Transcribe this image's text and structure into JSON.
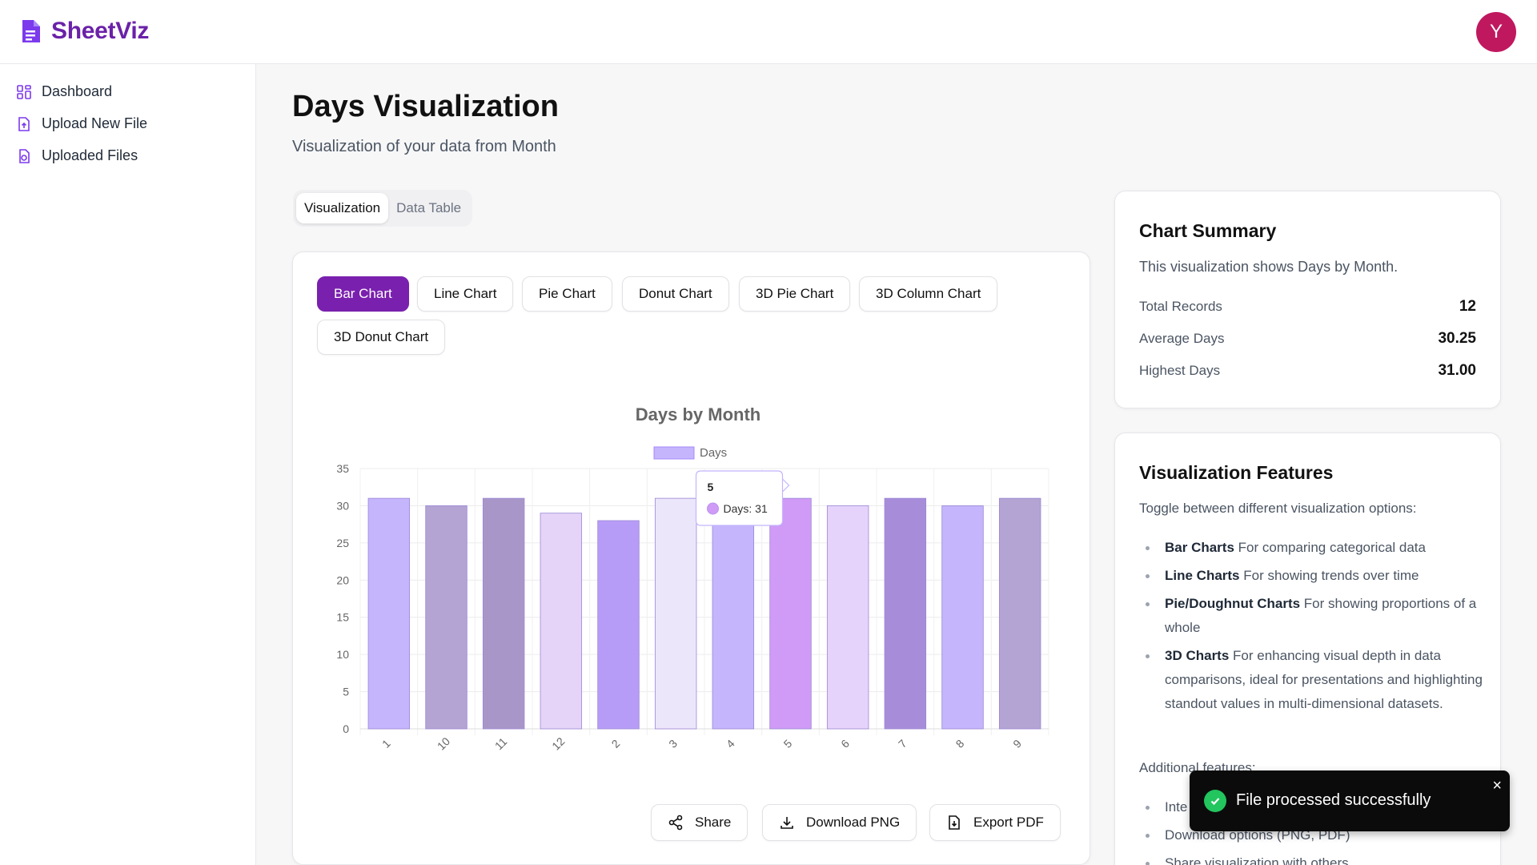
{
  "brand": {
    "name": "SheetViz"
  },
  "user": {
    "avatar_letter": "Y",
    "avatar_color": "#c0185f"
  },
  "sidebar": {
    "items": [
      {
        "label": "Dashboard",
        "icon": "grid-icon"
      },
      {
        "label": "Upload New File",
        "icon": "file-upload-icon"
      },
      {
        "label": "Uploaded Files",
        "icon": "files-icon"
      }
    ]
  },
  "page": {
    "title": "Days Visualization",
    "subtitle": "Visualization of your data from Month"
  },
  "tabs": [
    {
      "label": "Visualization",
      "active": true
    },
    {
      "label": "Data Table",
      "active": false
    }
  ],
  "chart_types": [
    {
      "label": "Bar Chart",
      "active": true
    },
    {
      "label": "Line Chart"
    },
    {
      "label": "Pie Chart"
    },
    {
      "label": "Donut Chart"
    },
    {
      "label": "3D Pie Chart"
    },
    {
      "label": "3D Column Chart"
    },
    {
      "label": "3D Donut Chart"
    }
  ],
  "tooltip": {
    "title": "5",
    "text": "Days: 31"
  },
  "chart_data": {
    "type": "bar",
    "title": "Days by Month",
    "xlabel": "",
    "ylabel": "",
    "categories": [
      "1",
      "10",
      "11",
      "12",
      "2",
      "3",
      "4",
      "5",
      "6",
      "7",
      "8",
      "9"
    ],
    "series": [
      {
        "name": "Days",
        "values": [
          31,
          30,
          31,
          29,
          28,
          31,
          30,
          31,
          30,
          31,
          30,
          31
        ]
      }
    ],
    "ylim": [
      0,
      35
    ],
    "yticks": [
      0,
      5,
      10,
      15,
      20,
      25,
      30,
      35
    ],
    "legend": "top",
    "grid": true,
    "bar_colors": [
      "#c4b5fd",
      "#b3a4d3",
      "#a996c9",
      "#e5d4f7",
      "#b79cf7",
      "#ece6fb",
      "#c4b5fd",
      "#cf9bf6",
      "#e6d3fb",
      "#a78dd9",
      "#c4b5fd",
      "#b3a4d3"
    ],
    "legend_color": "#c4b5fd"
  },
  "actions": {
    "share": "Share",
    "download_png": "Download PNG",
    "export_pdf": "Export PDF"
  },
  "summary": {
    "title": "Chart Summary",
    "description": "This visualization shows Days by Month.",
    "stats": [
      {
        "label": "Total Records",
        "value": "12"
      },
      {
        "label": "Average Days",
        "value": "30.25"
      },
      {
        "label": "Highest Days",
        "value": "31.00"
      }
    ]
  },
  "features": {
    "title": "Visualization Features",
    "intro": "Toggle between different visualization options:",
    "items": [
      {
        "bold": "Bar Charts",
        "text": " For comparing categorical data"
      },
      {
        "bold": "Line Charts",
        "text": " For showing trends over time"
      },
      {
        "bold": "Pie/Doughnut Charts",
        "text": " For showing proportions of a whole"
      },
      {
        "bold": "3D Charts",
        "text": " For enhancing visual depth in data comparisons, ideal for presentations and highlighting standout values in multi-dimensional datasets."
      }
    ],
    "additional_label": "Additional features:",
    "additional_items": [
      "Inte",
      "Download options (PNG, PDF)",
      "Share visualization with others"
    ]
  },
  "toast": {
    "message": "File processed successfully",
    "close": "×"
  },
  "colors": {
    "accent": "#7a20ae",
    "brand": "#6b21a8",
    "success": "#22c55e"
  }
}
